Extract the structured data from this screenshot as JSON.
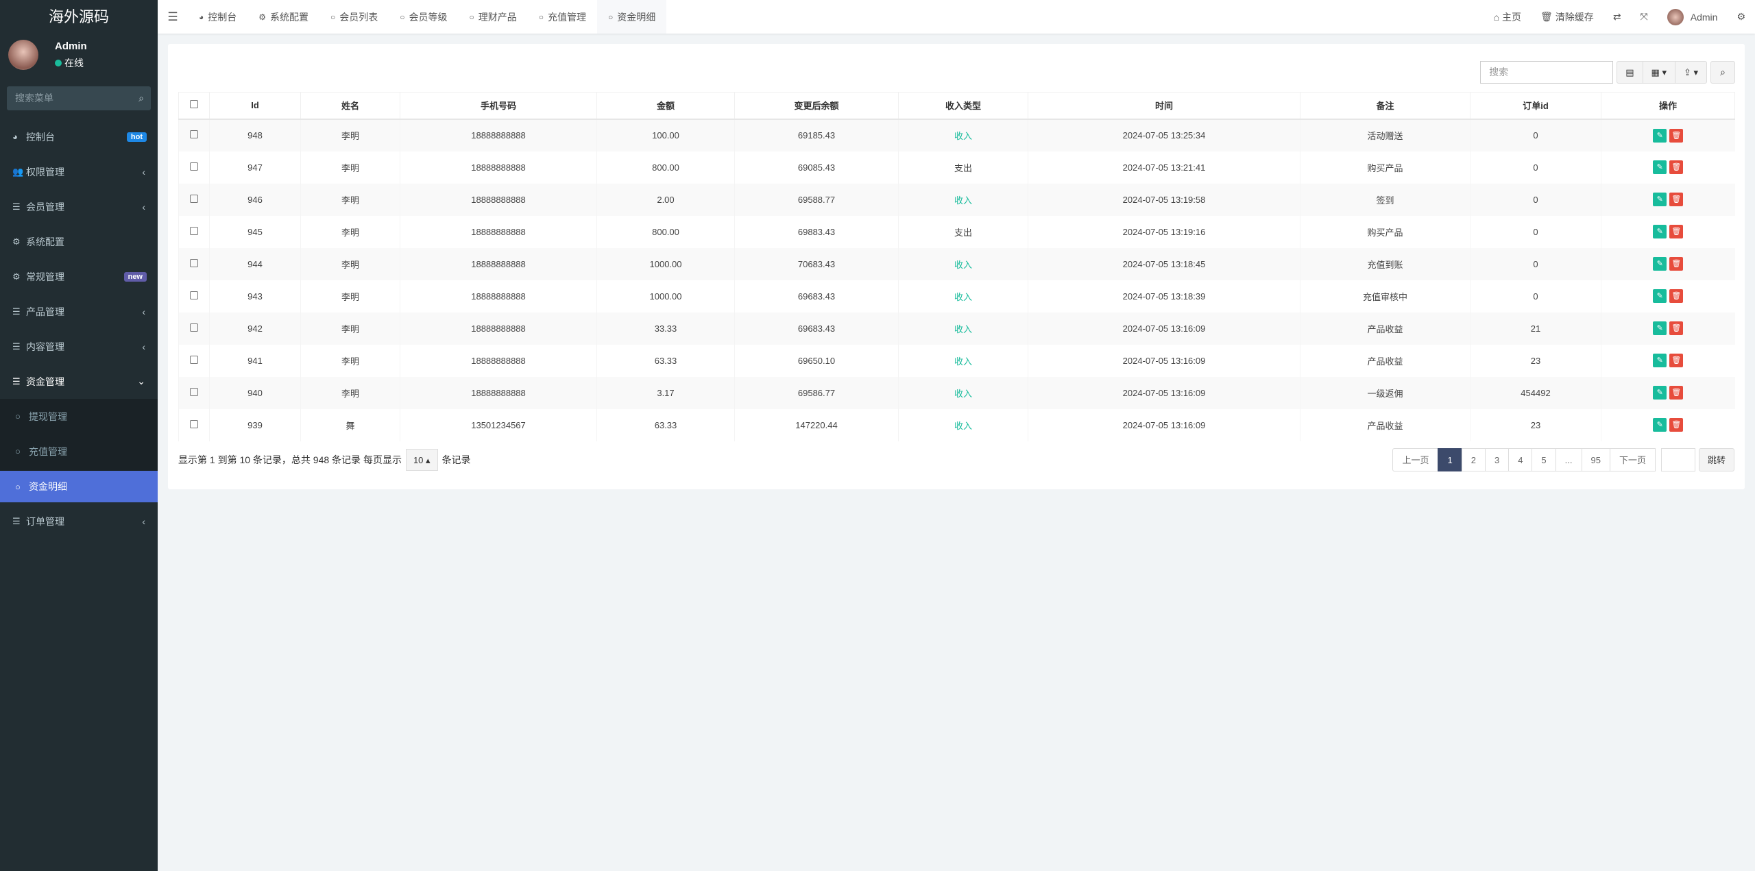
{
  "sidebar": {
    "logo": "海外源码",
    "user": {
      "name": "Admin",
      "status": "在线"
    },
    "search_placeholder": "搜索菜单",
    "items": [
      {
        "label": "控制台",
        "icon": "dashboard-icon",
        "glyph": "◕",
        "badge": "hot",
        "badge_color": "#1e88e5"
      },
      {
        "label": "权限管理",
        "icon": "users-icon",
        "glyph": "👥",
        "arrow": "‹"
      },
      {
        "label": "会员管理",
        "icon": "list-icon",
        "glyph": "☰",
        "arrow": "‹"
      },
      {
        "label": "系统配置",
        "icon": "gear-icon",
        "glyph": "⚙"
      },
      {
        "label": "常规管理",
        "icon": "gears-icon",
        "glyph": "⚙",
        "badge": "new",
        "badge_color": "#605ca8"
      },
      {
        "label": "产品管理",
        "icon": "list-icon",
        "glyph": "☰",
        "arrow": "‹"
      },
      {
        "label": "内容管理",
        "icon": "list-icon",
        "glyph": "☰",
        "arrow": "‹"
      },
      {
        "label": "资金管理",
        "icon": "list-icon",
        "glyph": "☰",
        "arrow": "⌄",
        "open": true
      },
      {
        "label": "提现管理",
        "icon": "circle-icon",
        "glyph": "○",
        "sub": true
      },
      {
        "label": "充值管理",
        "icon": "circle-icon",
        "glyph": "○",
        "sub": true
      },
      {
        "label": "资金明细",
        "icon": "circle-icon",
        "glyph": "○",
        "sub": true,
        "active": true
      },
      {
        "label": "订单管理",
        "icon": "list-icon",
        "glyph": "☰",
        "arrow": "‹"
      }
    ]
  },
  "header": {
    "tabs": [
      {
        "label": "控制台",
        "icon": "dashboard-icon",
        "glyph": "◕"
      },
      {
        "label": "系统配置",
        "icon": "gear-icon",
        "glyph": "⚙"
      },
      {
        "label": "会员列表",
        "icon": "circle-icon",
        "glyph": "○"
      },
      {
        "label": "会员等级",
        "icon": "circle-icon",
        "glyph": "○"
      },
      {
        "label": "理财产品",
        "icon": "circle-icon",
        "glyph": "○"
      },
      {
        "label": "充值管理",
        "icon": "circle-icon",
        "glyph": "○"
      },
      {
        "label": "资金明细",
        "icon": "circle-icon",
        "glyph": "○",
        "active": true
      }
    ],
    "home": "主页",
    "clear_cache": "清除缓存",
    "user": "Admin"
  },
  "toolbar": {
    "search_placeholder": "搜索"
  },
  "table": {
    "columns": [
      "Id",
      "姓名",
      "手机号码",
      "金额",
      "变更后余额",
      "收入类型",
      "时间",
      "备注",
      "订单id",
      "操作"
    ],
    "rows": [
      {
        "id": "948",
        "name": "李明",
        "phone": "18888888888",
        "amount": "100.00",
        "balance": "69185.43",
        "type": "收入",
        "time": "2024-07-05 13:25:34",
        "remark": "活动赠送",
        "order": "0"
      },
      {
        "id": "947",
        "name": "李明",
        "phone": "18888888888",
        "amount": "800.00",
        "balance": "69085.43",
        "type": "支出",
        "time": "2024-07-05 13:21:41",
        "remark": "购买产品",
        "order": "0"
      },
      {
        "id": "946",
        "name": "李明",
        "phone": "18888888888",
        "amount": "2.00",
        "balance": "69588.77",
        "type": "收入",
        "time": "2024-07-05 13:19:58",
        "remark": "签到",
        "order": "0"
      },
      {
        "id": "945",
        "name": "李明",
        "phone": "18888888888",
        "amount": "800.00",
        "balance": "69883.43",
        "type": "支出",
        "time": "2024-07-05 13:19:16",
        "remark": "购买产品",
        "order": "0"
      },
      {
        "id": "944",
        "name": "李明",
        "phone": "18888888888",
        "amount": "1000.00",
        "balance": "70683.43",
        "type": "收入",
        "time": "2024-07-05 13:18:45",
        "remark": "充值到账",
        "order": "0"
      },
      {
        "id": "943",
        "name": "李明",
        "phone": "18888888888",
        "amount": "1000.00",
        "balance": "69683.43",
        "type": "收入",
        "time": "2024-07-05 13:18:39",
        "remark": "充值审核中",
        "order": "0"
      },
      {
        "id": "942",
        "name": "李明",
        "phone": "18888888888",
        "amount": "33.33",
        "balance": "69683.43",
        "type": "收入",
        "time": "2024-07-05 13:16:09",
        "remark": "产品收益",
        "order": "21"
      },
      {
        "id": "941",
        "name": "李明",
        "phone": "18888888888",
        "amount": "63.33",
        "balance": "69650.10",
        "type": "收入",
        "time": "2024-07-05 13:16:09",
        "remark": "产品收益",
        "order": "23"
      },
      {
        "id": "940",
        "name": "李明",
        "phone": "18888888888",
        "amount": "3.17",
        "balance": "69586.77",
        "type": "收入",
        "time": "2024-07-05 13:16:09",
        "remark": "一级返佣",
        "order": "454492"
      },
      {
        "id": "939",
        "name": "舞",
        "phone": "13501234567",
        "amount": "63.33",
        "balance": "147220.44",
        "type": "收入",
        "time": "2024-07-05 13:16:09",
        "remark": "产品收益",
        "order": "23"
      }
    ]
  },
  "footer": {
    "summary": "显示第 1 到第 10 条记录，总共 948 条记录 每页显示",
    "page_size": "10",
    "suffix": "条记录",
    "prev": "上一页",
    "next": "下一页",
    "pages": [
      "1",
      "2",
      "3",
      "4",
      "5",
      "...",
      "95"
    ],
    "current_page": "1",
    "jump": "跳转"
  },
  "colors": {
    "income": "#18bc9c",
    "edit": "#18bc9c",
    "delete": "#e74c3c",
    "active": "#4f6fd9"
  }
}
